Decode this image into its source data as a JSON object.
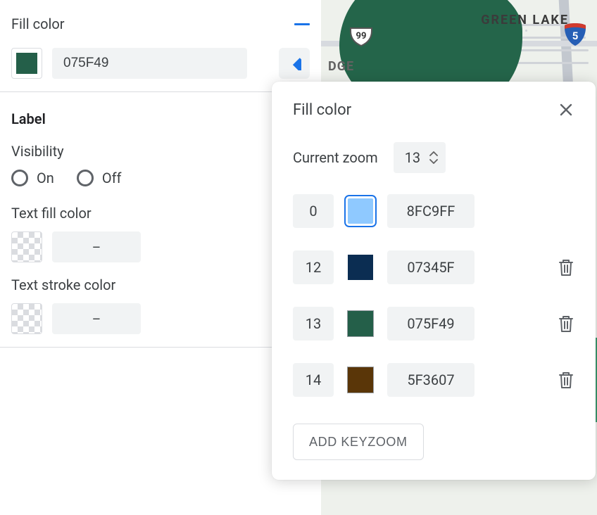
{
  "sidebar": {
    "fill_color": {
      "title": "Fill color",
      "hex": "075F49",
      "swatch": "#245f49"
    },
    "label_section": {
      "title": "Label",
      "visibility_label": "Visibility",
      "on_label": "On",
      "off_label": "Off",
      "text_fill_label": "Text fill color",
      "text_stroke_label": "Text stroke color",
      "empty_value": "–"
    }
  },
  "map": {
    "area_name": "GREEN LAKE",
    "sub_area": "DGE",
    "highway_number": "99",
    "interstate_number": "5"
  },
  "popover": {
    "title": "Fill color",
    "zoom_label": "Current zoom",
    "zoom_value": "13",
    "add_button": "ADD KEYZOOM",
    "keyzooms": [
      {
        "zoom": "0",
        "hex": "8FC9FF",
        "color": "#8fc9ff",
        "deletable": false,
        "selected": true,
        "bordered": false
      },
      {
        "zoom": "12",
        "hex": "07345F",
        "color": "#0b2d52",
        "deletable": true,
        "selected": false,
        "bordered": false
      },
      {
        "zoom": "13",
        "hex": "075F49",
        "color": "#245f49",
        "deletable": true,
        "selected": false,
        "bordered": true
      },
      {
        "zoom": "14",
        "hex": "5F3607",
        "color": "#5a3608",
        "deletable": true,
        "selected": false,
        "bordered": true
      }
    ]
  }
}
